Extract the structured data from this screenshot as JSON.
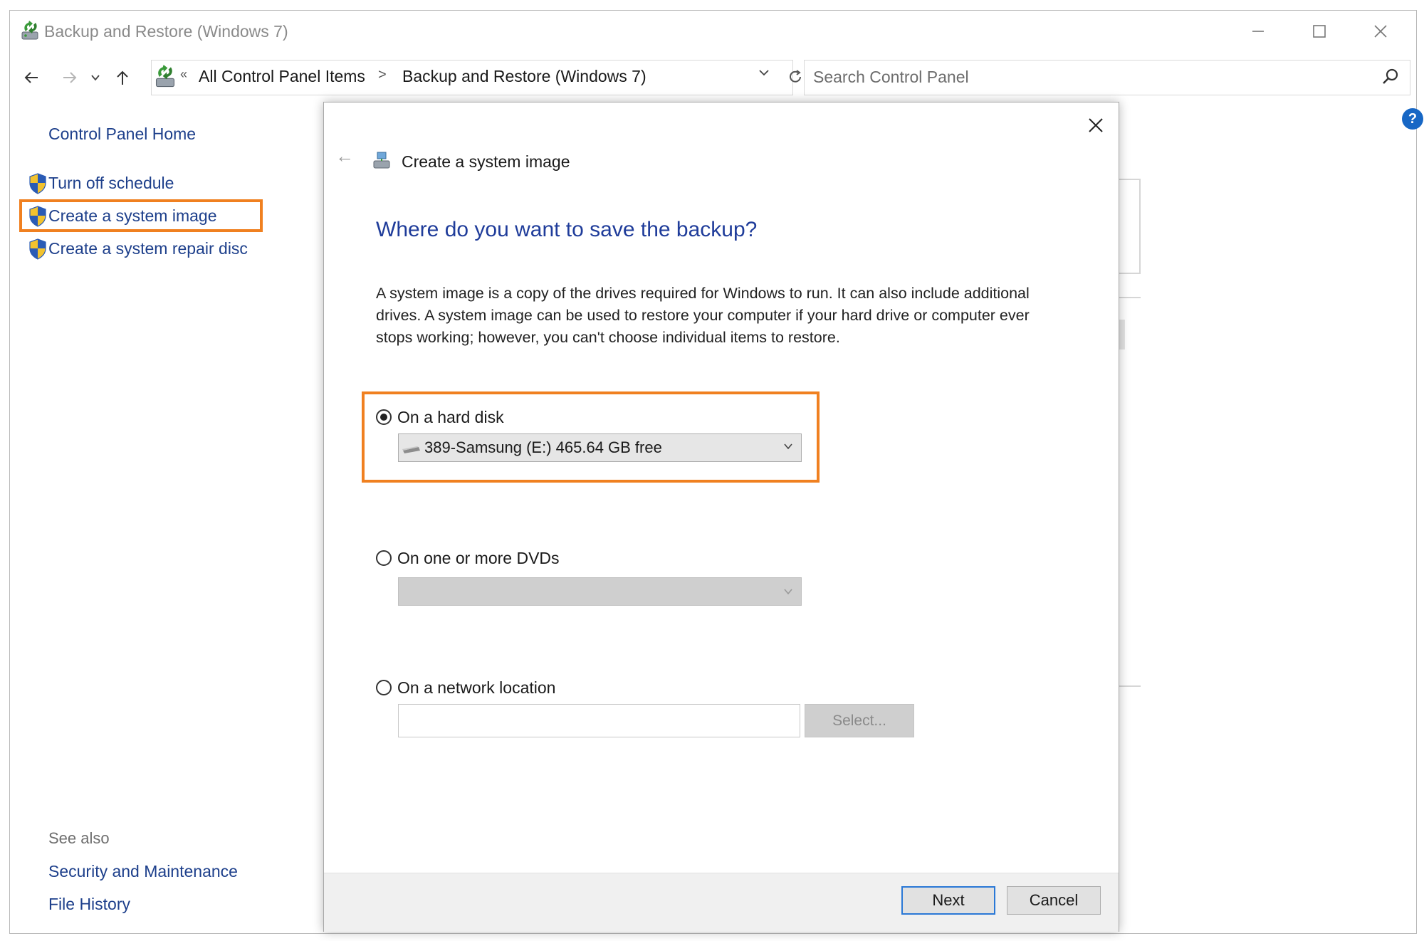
{
  "window": {
    "title": "Backup and Restore (Windows 7)"
  },
  "address_bar": {
    "overflow_chevron": "«",
    "breadcrumbs": [
      "All Control Panel Items",
      "Backup and Restore (Windows 7)"
    ],
    "separator": ">"
  },
  "search": {
    "placeholder": "Search Control Panel"
  },
  "sidebar": {
    "home_link": "Control Panel Home",
    "tasks": [
      {
        "label": "Turn off schedule",
        "icon": "uac-shield-icon"
      },
      {
        "label": "Create a system image",
        "icon": "uac-shield-icon",
        "highlighted": true
      },
      {
        "label": "Create a system repair disc",
        "icon": "uac-shield-icon"
      }
    ],
    "see_also_heading": "See also",
    "see_also_links": [
      "Security and Maintenance",
      "File History"
    ]
  },
  "help": {
    "glyph": "?"
  },
  "dialog": {
    "back_arrow": "←",
    "title": "Create a system image",
    "question": "Where do you want to save the backup?",
    "description": "A system image is a copy of the drives required for Windows to run. It can also include additional drives. A system image can be used to restore your computer if your hard drive or computer ever stops working; however, you can't choose individual items to restore.",
    "options": [
      {
        "label": "On a hard disk",
        "selected": true,
        "value": "389-Samsung (E:)  465.64 GB free"
      },
      {
        "label": "On one or more DVDs",
        "selected": false,
        "value": ""
      },
      {
        "label": "On a network location",
        "selected": false,
        "value": ""
      }
    ],
    "select_button": "Select...",
    "next_button": "Next",
    "cancel_button": "Cancel"
  },
  "colors": {
    "highlight": "#f08020",
    "link": "#1d3f8b",
    "heading": "#1f3c9a",
    "focus_border": "#2a78d6"
  }
}
